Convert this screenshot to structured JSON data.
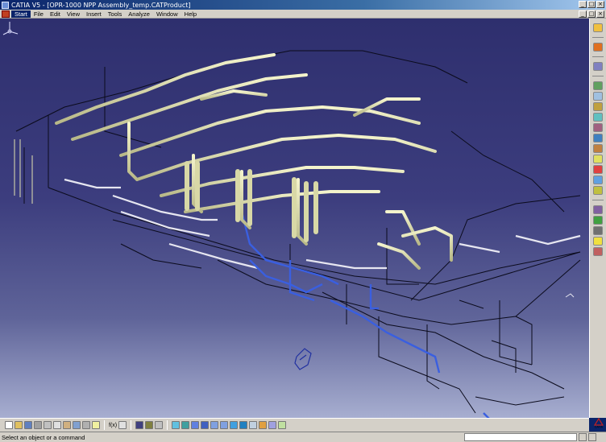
{
  "window": {
    "title": "CATIA V5 - [OPR-1000 NPP Assembly_temp.CATProduct]",
    "controls": [
      "minimize",
      "maximize",
      "close"
    ]
  },
  "menu": {
    "items": [
      "Start",
      "File",
      "Edit",
      "View",
      "Insert",
      "Tools",
      "Analyze",
      "Window",
      "Help"
    ]
  },
  "toolbar_bottom": {
    "formula_label": "f(x)"
  },
  "toolbar_right": {
    "icons": [
      "select-icon",
      "sketcher-icon",
      "assembly-icon",
      "constraint-icon",
      "fix-icon",
      "contact-icon",
      "offset-icon",
      "angle-icon",
      "update-icon",
      "explode-icon",
      "manipulate-icon",
      "clash-icon",
      "section-icon",
      "measure-icon",
      "bom-icon",
      "snap-icon",
      "catalog-icon",
      "light-icon",
      "scene-icon"
    ]
  },
  "status": {
    "message": "Select an object or a command",
    "command_value": ""
  },
  "viewport": {
    "background_top": "#2e2f6e",
    "background_bottom": "#a7aed0",
    "pipe_color": "#e8e8b4",
    "highlight_color": "#3a5fe0",
    "structure_color": "#101020"
  }
}
